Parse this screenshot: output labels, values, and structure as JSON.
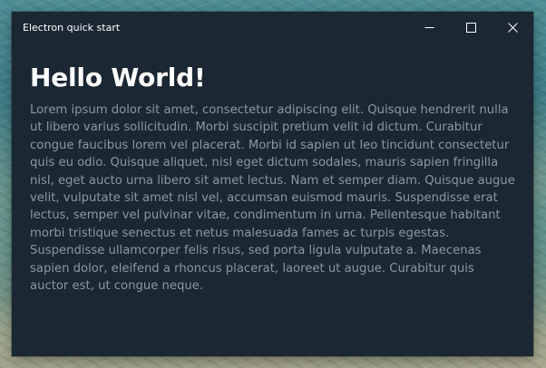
{
  "window": {
    "title": "Electron quick start",
    "controls": {
      "minimize_icon": "minimize-icon",
      "maximize_icon": "maximize-icon",
      "close_icon": "close-icon"
    }
  },
  "content": {
    "heading": "Hello World!",
    "paragraph": "Lorem ipsum dolor sit amet, consectetur adipiscing elit. Quisque hendrerit nulla ut libero varius sollicitudin. Morbi suscipit pretium velit id dictum. Curabitur congue faucibus lorem vel placerat. Morbi id sapien ut leo tincidunt consectetur quis eu odio. Quisque aliquet, nisl eget dictum sodales, mauris sapien fringilla nisl, eget aucto urna libero sit amet lectus. Nam et semper diam. Quisque augue velit, vulputate sit amet nisl vel, accumsan euismod mauris. Suspendisse erat lectus, semper vel pulvinar vitae, condimentum in urna. Pellentesque habitant morbi tristique senectus et netus malesuada fames ac turpis egestas. Suspendisse ullamcorper felis risus, sed porta ligula vulputate a. Maecenas sapien dolor, eleifend a rhoncus placerat, laoreet ut augue. Curabitur quis auctor est, ut congue neque."
  },
  "colors": {
    "window_background": "#1b2733",
    "heading": "#ffffff",
    "paragraph": "#8b97a3"
  }
}
